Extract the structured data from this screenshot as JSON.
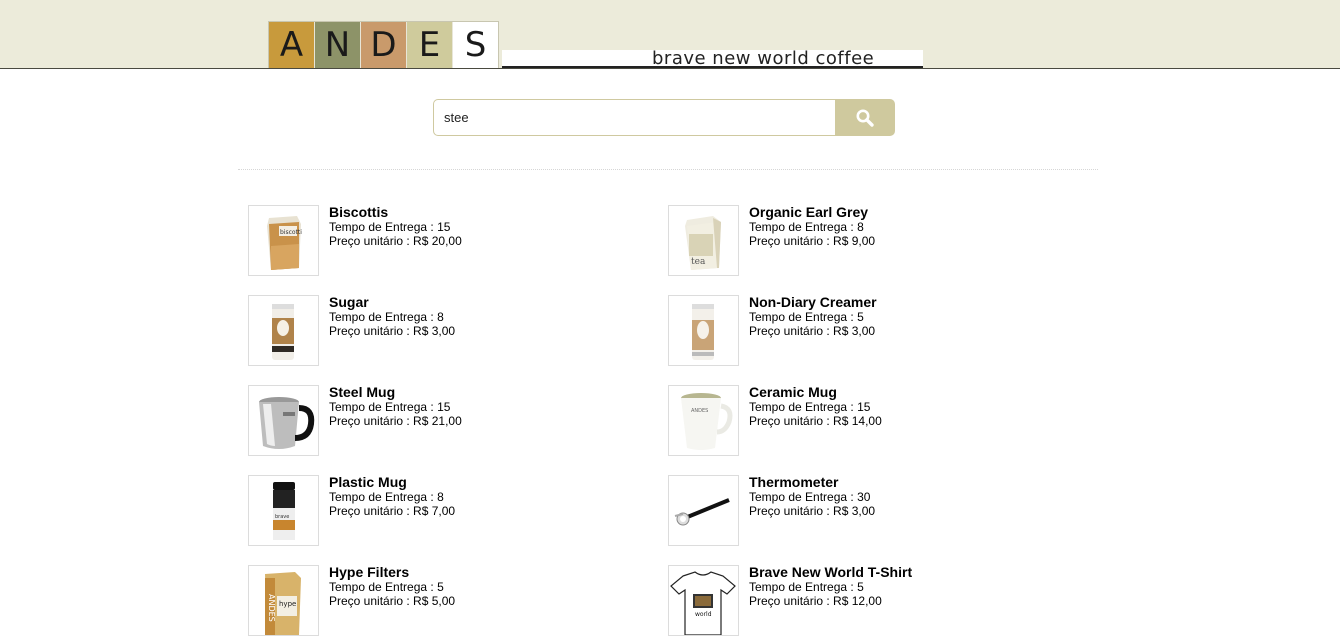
{
  "brand": {
    "logo_letters": [
      "A",
      "N",
      "D",
      "E",
      "S"
    ],
    "logo_colors": [
      "#c89a3c",
      "#8d9368",
      "#c99a6b",
      "#cfcb9c",
      "#ffffff"
    ],
    "tagline": "brave new world coffee"
  },
  "search": {
    "value": "stee",
    "button_icon": "search-icon"
  },
  "labels": {
    "delivery": "Tempo de Entrega : ",
    "price": "Preço unitário : "
  },
  "products": [
    {
      "name": "Biscottis",
      "delivery": "15",
      "price": "R$ 20,00",
      "image": "biscotti-box"
    },
    {
      "name": "Organic Earl Grey",
      "delivery": "8",
      "price": "R$ 9,00",
      "image": "tea-box"
    },
    {
      "name": "Sugar",
      "delivery": "8",
      "price": "R$ 3,00",
      "image": "sugar-canister"
    },
    {
      "name": "Non-Diary Creamer",
      "delivery": "5",
      "price": "R$ 3,00",
      "image": "creamer-canister"
    },
    {
      "name": "Steel Mug",
      "delivery": "15",
      "price": "R$ 21,00",
      "image": "steel-mug"
    },
    {
      "name": "Ceramic Mug",
      "delivery": "15",
      "price": "R$ 14,00",
      "image": "ceramic-mug"
    },
    {
      "name": "Plastic Mug",
      "delivery": "8",
      "price": "R$ 7,00",
      "image": "plastic-tumbler"
    },
    {
      "name": "Thermometer",
      "delivery": "30",
      "price": "R$ 3,00",
      "image": "thermometer"
    },
    {
      "name": "Hype Filters",
      "delivery": "5",
      "price": "R$ 5,00",
      "image": "filter-box"
    },
    {
      "name": "Brave New World T-Shirt",
      "delivery": "5",
      "price": "R$ 12,00",
      "image": "t-shirt"
    }
  ]
}
